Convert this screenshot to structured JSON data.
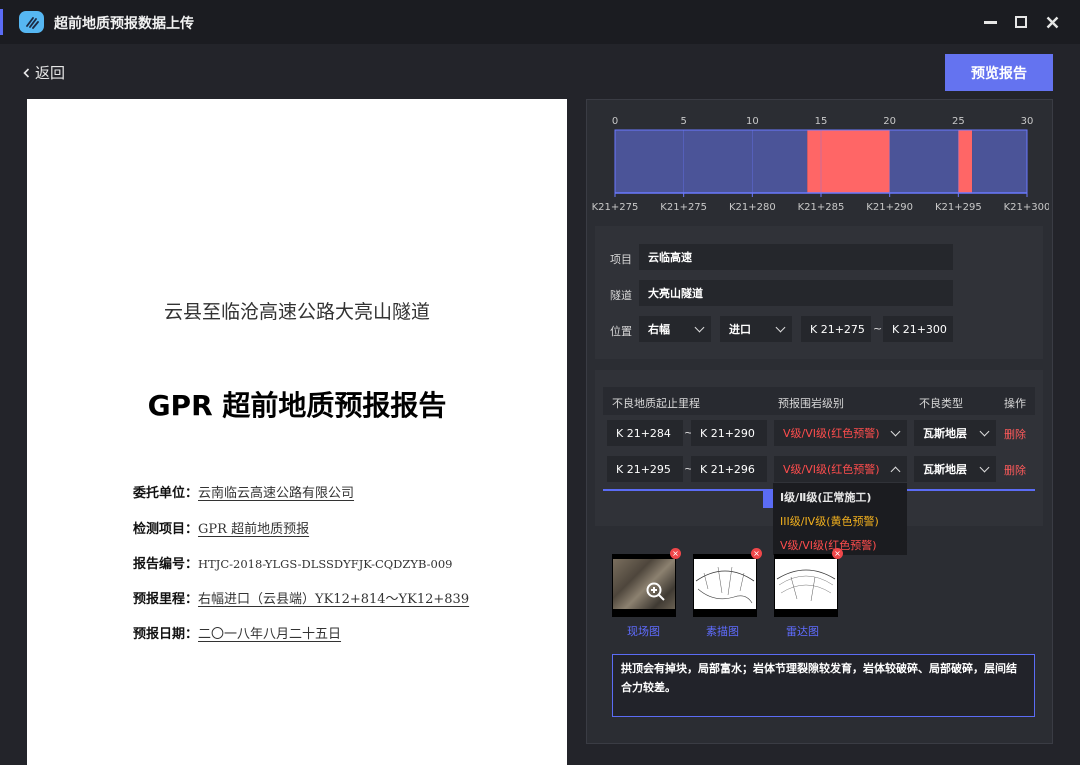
{
  "app": {
    "title": "超前地质预报数据上传"
  },
  "nav": {
    "back_label": "返回",
    "preview_label": "预览报告"
  },
  "report": {
    "subtitle": "云县至临沧高速公路大亮山隧道",
    "title": "GPR 超前地质预报报告",
    "rows": [
      {
        "key": "委托单位：",
        "value": "云南临云高速公路有限公司"
      },
      {
        "key": "检测项目：",
        "value": "GPR 超前地质预报"
      },
      {
        "key": "报告编号：",
        "value": "HTJC-2018-YLGS-DLSSDYFJK-CQDZYB-009"
      },
      {
        "key": "预报里程：",
        "value": "右幅进口（云县端）YK12+814～YK12+839"
      },
      {
        "key": "预报日期：",
        "value": "二〇一八年八月二十五日"
      }
    ]
  },
  "chart_data": {
    "type": "bar",
    "x_ticks": [
      0,
      5,
      10,
      15,
      20,
      25,
      30
    ],
    "xlim": [
      0,
      30
    ],
    "bottom_labels": [
      "K21+275",
      "K21+275",
      "K21+280",
      "K21+285",
      "K21+290",
      "K21+295",
      "K21+300"
    ],
    "segments": [
      {
        "start": 0,
        "end": 14,
        "level": "normal"
      },
      {
        "start": 14,
        "end": 20,
        "level": "red"
      },
      {
        "start": 20,
        "end": 25,
        "level": "normal"
      },
      {
        "start": 25,
        "end": 26,
        "level": "red"
      },
      {
        "start": 26,
        "end": 30,
        "level": "normal"
      }
    ],
    "colors": {
      "normal": "#4b5498",
      "red": "#ff6666",
      "axis": "#6b79ff"
    }
  },
  "form": {
    "project_label": "项目",
    "project_value": "云临高速",
    "tunnel_label": "隧道",
    "tunnel_value": "大亮山隧道",
    "position_label": "位置",
    "side_value": "右幅",
    "entry_value": "进口",
    "start_mileage": "K 21+275",
    "tilde": "~",
    "end_mileage": "K 21+300"
  },
  "table": {
    "headers": [
      "不良地质起止里程",
      "预报围岩级别",
      "不良类型",
      "操作"
    ],
    "rows": [
      {
        "start": "K 21+284",
        "end": "K 21+290",
        "level": "V级/VI级(红色预警)",
        "type": "瓦斯地层",
        "action": "删除"
      },
      {
        "start": "K 21+295",
        "end": "K 21+296",
        "level": "V级/VI级(红色预警)",
        "type": "瓦斯地层",
        "action": "删除"
      }
    ],
    "tilde": "~"
  },
  "dropdown": {
    "options": [
      {
        "label": "Ⅰ级/Ⅱ级(正常施工)",
        "color": "#ffffff"
      },
      {
        "label": "III级/IV级(黄色预警)",
        "color": "#f2b01e"
      },
      {
        "label": "V级/VI级(红色预警)",
        "color": "#ff4d4d"
      }
    ]
  },
  "images": [
    {
      "caption": "现场图",
      "remove": "×"
    },
    {
      "caption": "素描图",
      "remove": "×"
    },
    {
      "caption": "雷达图",
      "remove": "×"
    }
  ],
  "description": "拱顶会有掉块，局部富水；岩体节理裂隙较发育，岩体较破碎、局部破碎，层间结合力较差。"
}
